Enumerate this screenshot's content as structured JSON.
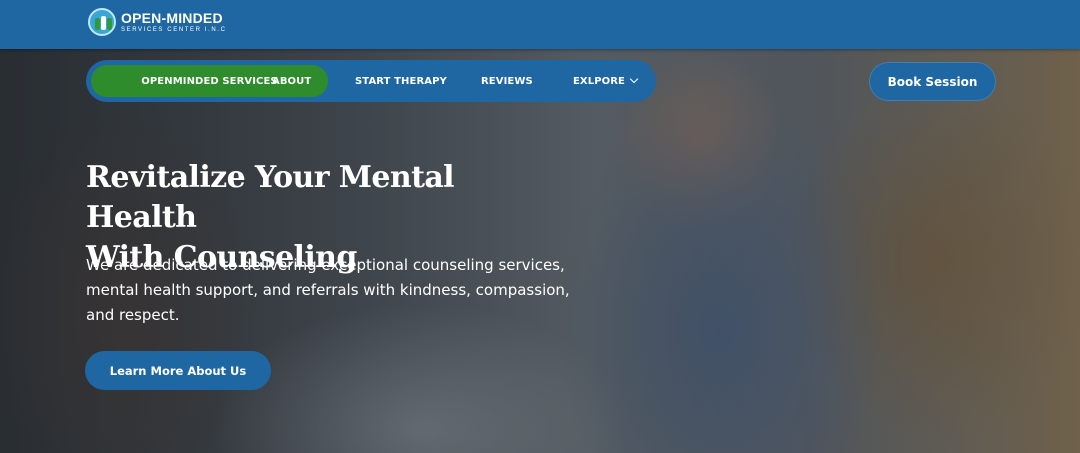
{
  "brand": {
    "name": "OPEN-MINDED",
    "subtitle": "SERVICES CENTER I.N.C",
    "logo_icon": "open-minded-logo-icon"
  },
  "nav": {
    "items": [
      {
        "label": "OPENMINDED SERVICES",
        "active": true
      },
      {
        "label": "ABOUT",
        "active": false
      },
      {
        "label": "START THERAPY",
        "active": false
      },
      {
        "label": "REVIEWS",
        "active": false
      },
      {
        "label": "EXLPORE",
        "active": false,
        "icon": "chevron-down-icon"
      }
    ],
    "cta_label": "Book Session"
  },
  "hero": {
    "headline_line1": "Revitalize Your Mental Health",
    "headline_line2": "With Counseling",
    "description": "We are dedicated to delivering exceptional counseling services, mental health support, and referrals with kindness, compassion, and respect.",
    "button_label": "Learn More About Us"
  },
  "colors": {
    "primary_blue": "#1f67a3",
    "active_green": "#2f8c2c",
    "text_white": "#ffffff"
  }
}
